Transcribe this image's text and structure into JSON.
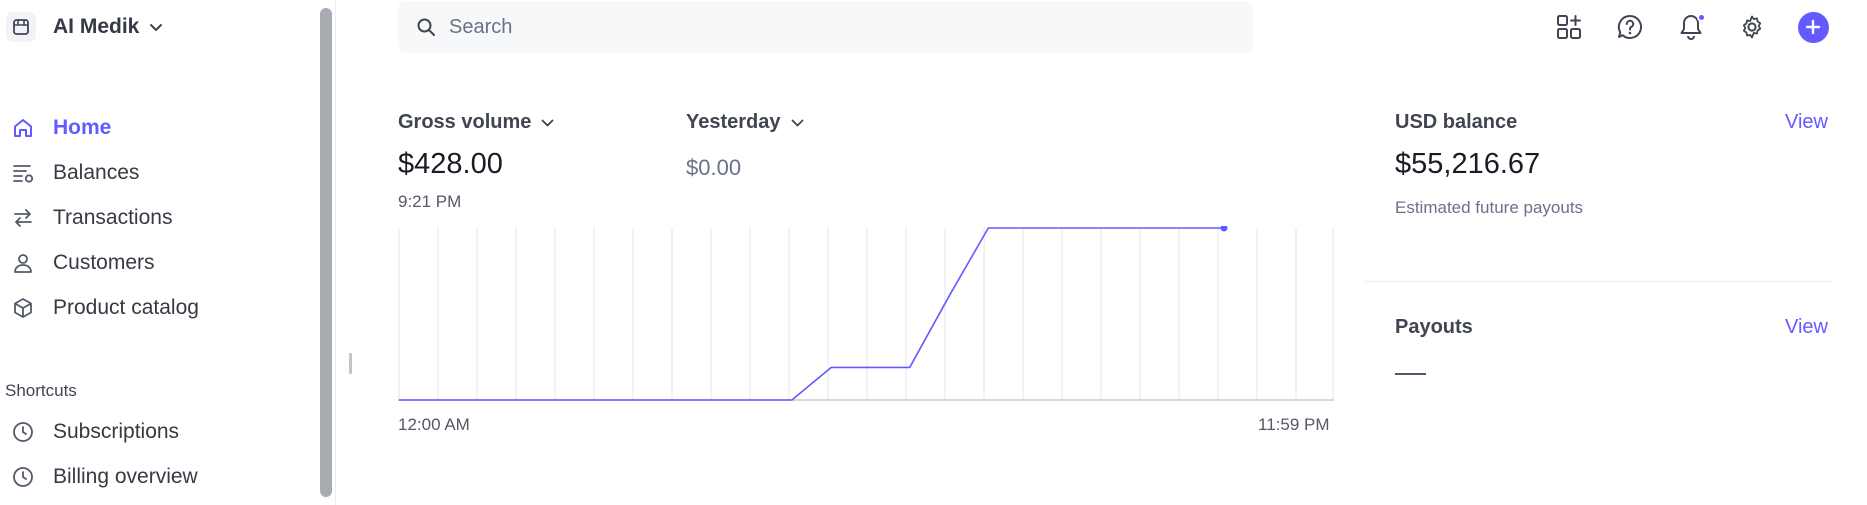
{
  "account": {
    "name": "AI Medik"
  },
  "nav": {
    "items": [
      {
        "label": "Home",
        "icon": "home-icon",
        "active": true
      },
      {
        "label": "Balances",
        "icon": "balances-icon",
        "active": false
      },
      {
        "label": "Transactions",
        "icon": "transactions-icon",
        "active": false
      },
      {
        "label": "Customers",
        "icon": "customers-icon",
        "active": false
      },
      {
        "label": "Product catalog",
        "icon": "product-catalog-icon",
        "active": false
      }
    ],
    "shortcuts_title": "Shortcuts",
    "shortcuts": [
      {
        "label": "Subscriptions",
        "icon": "clock-icon"
      },
      {
        "label": "Billing overview",
        "icon": "clock-icon"
      }
    ]
  },
  "search": {
    "placeholder": "Search"
  },
  "toolbar": {
    "icons": [
      "apps-icon",
      "help-icon",
      "notifications-icon",
      "settings-icon",
      "create-plus-icon"
    ]
  },
  "metrics": {
    "primary": {
      "label": "Gross volume",
      "value": "$428.00",
      "time": "9:21 PM"
    },
    "compare": {
      "label": "Yesterday",
      "value": "$0.00"
    }
  },
  "chart_data": {
    "type": "line",
    "title": "",
    "xlabel": "",
    "ylabel": "",
    "x_start_label": "12:00 AM",
    "x_end_label": "11:59 PM",
    "x": [
      0,
      1,
      2,
      3,
      4,
      5,
      6,
      7,
      8,
      9,
      10,
      11,
      12,
      13,
      14,
      15,
      16,
      17,
      18,
      19,
      20,
      21
    ],
    "series": [
      {
        "values": [
          0,
          0,
          0,
          0,
          0,
          0,
          0,
          0,
          0,
          0,
          0,
          81,
          81,
          81,
          258,
          428,
          428,
          428,
          428,
          428,
          428,
          428
        ]
      }
    ],
    "ylim": [
      0,
      428
    ],
    "grid": true,
    "line_color": "#635bff"
  },
  "balance": {
    "title": "USD balance",
    "view_label": "View",
    "value": "$55,216.67",
    "subtitle": "Estimated future payouts"
  },
  "payouts": {
    "title": "Payouts",
    "view_label": "View"
  },
  "colors": {
    "accent": "#635bff",
    "text": "#353a44",
    "muted": "#687385"
  }
}
